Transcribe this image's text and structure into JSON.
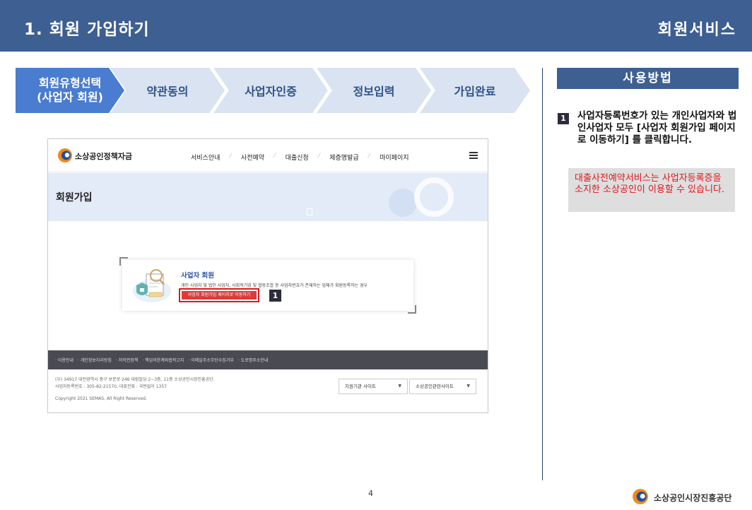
{
  "header": {
    "title": "1. 회원 가입하기",
    "section": "회원서비스"
  },
  "steps": [
    {
      "line1": "회원유형선택",
      "line2": "(사업자 회원)"
    },
    {
      "label": "약관동의"
    },
    {
      "label": "사업자인증"
    },
    {
      "label": "정보입력"
    },
    {
      "label": "가입완료"
    }
  ],
  "usage": {
    "header": "사용방법",
    "instruction_number": "1",
    "instruction_text": "사업자등록번호가 있는 개인사업자와 법인사업자 모두 [사업자 회원가입 페이지로 이동하기] 를 클릭합니다.",
    "note": "대출사전예약서비스는 사업자등록증을 소지한 소상공인이 이용할 수 있습니다."
  },
  "screenshot": {
    "brand": "소상공인정책자금",
    "menu": [
      "서비스안내",
      "사전예약",
      "대출신청",
      "제증명발급",
      "마이페이지"
    ],
    "banner_title": "회원가입",
    "card": {
      "title": "사업자 회원",
      "desc": "개인 사업자 및 법인 사업자, 사회적기업 및 협동조합 등 사업자번호가 존재하는 업체가 회원등록하는 경우",
      "button": "사업자 회원가입 페이지로 이동하기",
      "marker": "1"
    },
    "footer_links": [
      "· 이용안내",
      "· 개인정보처리방침",
      "· 저작권정책",
      "· 책임의한계와법적고지",
      "· 이메일주소무단수집거부",
      "· 도로명주소안내"
    ],
    "footer_address": "(우) 34917 대전광역시 중구 보문로 246 대림빌딩 2~3층, 11층 소상공인시장진흥공단.",
    "footer_biz": "사업자등록번호 : 305-82-21570, 대표전화 : 국번없이 1357",
    "footer_copy": "Copyright 2021 SEMAS, All Right Reserved.",
    "select1": "지원기관 사이트",
    "select2": "소상공인관련사이트"
  },
  "page_number": "4",
  "org_name": "소상공인시장진흥공단",
  "colors": {
    "header_bg": "#3d5f92",
    "step_active": "#4a7ccf",
    "step_inactive": "#d9e3f1",
    "note_text": "#e0161d"
  }
}
